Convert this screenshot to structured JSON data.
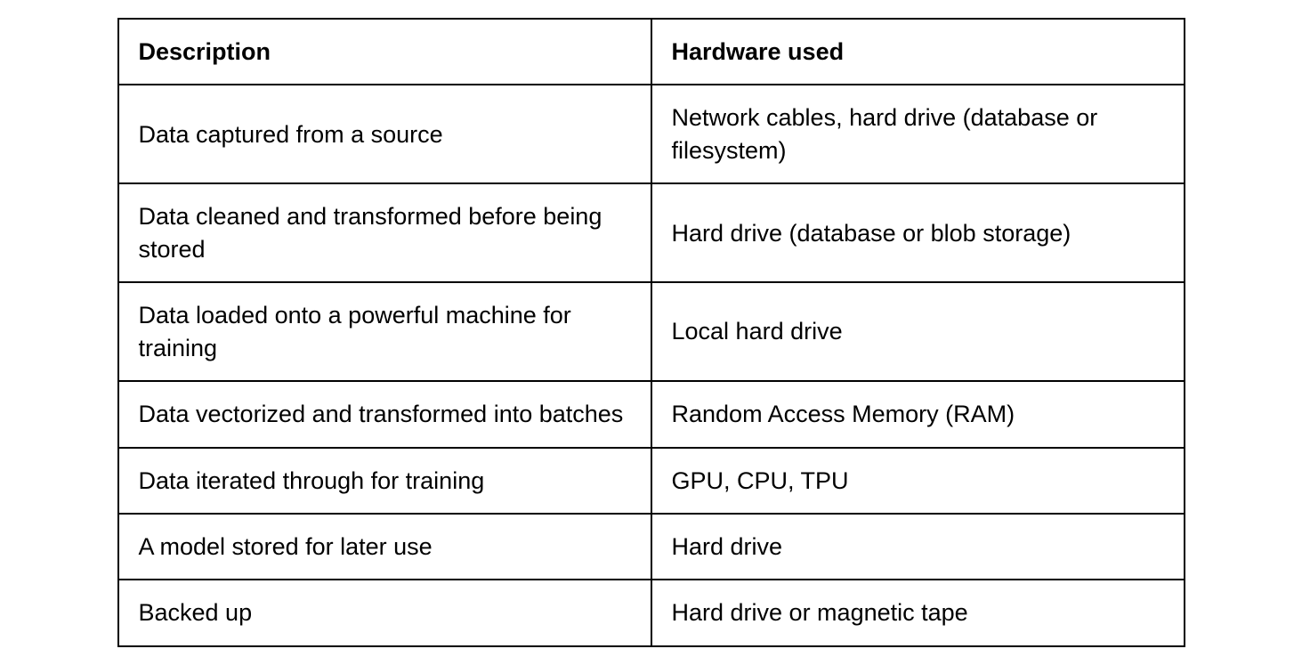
{
  "chart_data": {
    "type": "table",
    "headers": [
      "Description",
      "Hardware used"
    ],
    "rows": [
      [
        "Data captured from a source",
        "Network cables, hard drive (database or filesystem)"
      ],
      [
        "Data cleaned and transformed before being stored",
        "Hard drive (database or blob storage)"
      ],
      [
        "Data loaded onto a powerful machine for training",
        "Local hard drive"
      ],
      [
        "Data vectorized and transformed into batches",
        "Random Access Memory (RAM)"
      ],
      [
        "Data iterated through for training",
        "GPU, CPU, TPU"
      ],
      [
        "A model stored for later use",
        "Hard drive"
      ],
      [
        "Backed up",
        "Hard drive or magnetic tape"
      ]
    ]
  }
}
